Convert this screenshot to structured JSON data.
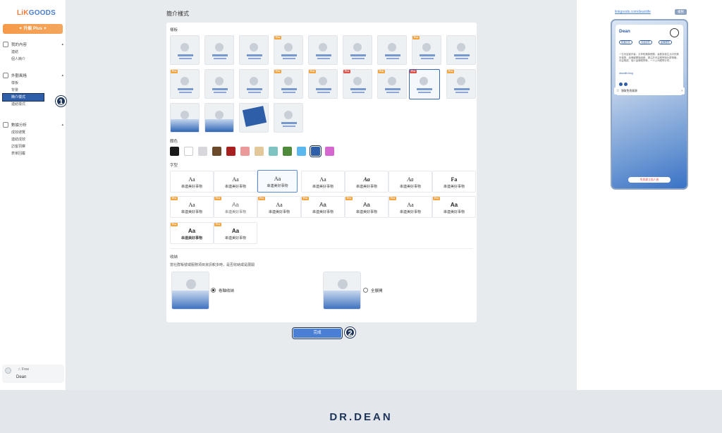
{
  "sidebar": {
    "logo_li": "LiK",
    "logo_rest": "GOODS",
    "upgrade": "✦ 升級 Plus ✦",
    "groups": [
      {
        "title": "我的內容",
        "items": [
          "連結",
          "個人簡介"
        ]
      },
      {
        "title": "外觀風格",
        "items": [
          "樣板",
          "背景",
          "簡介樣式",
          "連結樣式"
        ]
      },
      {
        "title": "數據分析",
        "items": [
          "成效總覽",
          "連結成效",
          "訪客洞察",
          "表單回覆"
        ]
      }
    ],
    "user": {
      "plan": "☆ Free",
      "name": "Dean"
    }
  },
  "steps": [
    "1",
    "2"
  ],
  "main": {
    "title": "簡介樣式",
    "template_label": "樣板",
    "color_label": "顏色",
    "font_label": "字型",
    "collapse_label": "收納",
    "collapse_desc": "當社群帳號或服務項目資訊較多時，是否收納或是展開",
    "option_collapse": "卷軸收納",
    "option_expand": "全展開",
    "done": "完成",
    "pro_tag": "Pro",
    "colors": [
      "#1a1a1a",
      "#ffffff",
      "#d8d8dc",
      "#6b4a2b",
      "#a81f1f",
      "#eb9a9a",
      "#e3c89a",
      "#7fc3c2",
      "#4f8a3a",
      "#5bb8ef",
      "#2f5ea8",
      "#d667d0"
    ],
    "font_sample": "串連美好事物",
    "font_glyphs": [
      "Aa",
      "Aa",
      "Aa",
      "Aa",
      "Aa",
      "Aa",
      "Fa",
      "Aa",
      "Aa",
      "Aa",
      "Aa",
      "Aa",
      "Aa",
      "Aa",
      "Aa",
      "Aa"
    ]
  },
  "preview": {
    "url": "linkgoods.com/deanlife",
    "copy": "複製",
    "name": "Dean",
    "chips": [
      "知識分享",
      "內容創作",
      "品牌經營"
    ],
    "bio": "一位內容創作者，分享知識與經驗，喜歡探索生活中的美好事物，品牌顧問與講師，專注於內容經營與社群策略，內容策劃、個人品牌經營等，一人公司經營分享。",
    "link": "deanlife.blog",
    "promo": "領取免費資源",
    "join": "免費建立個人頁"
  },
  "footer": {
    "brand": "DR.DEAN"
  }
}
